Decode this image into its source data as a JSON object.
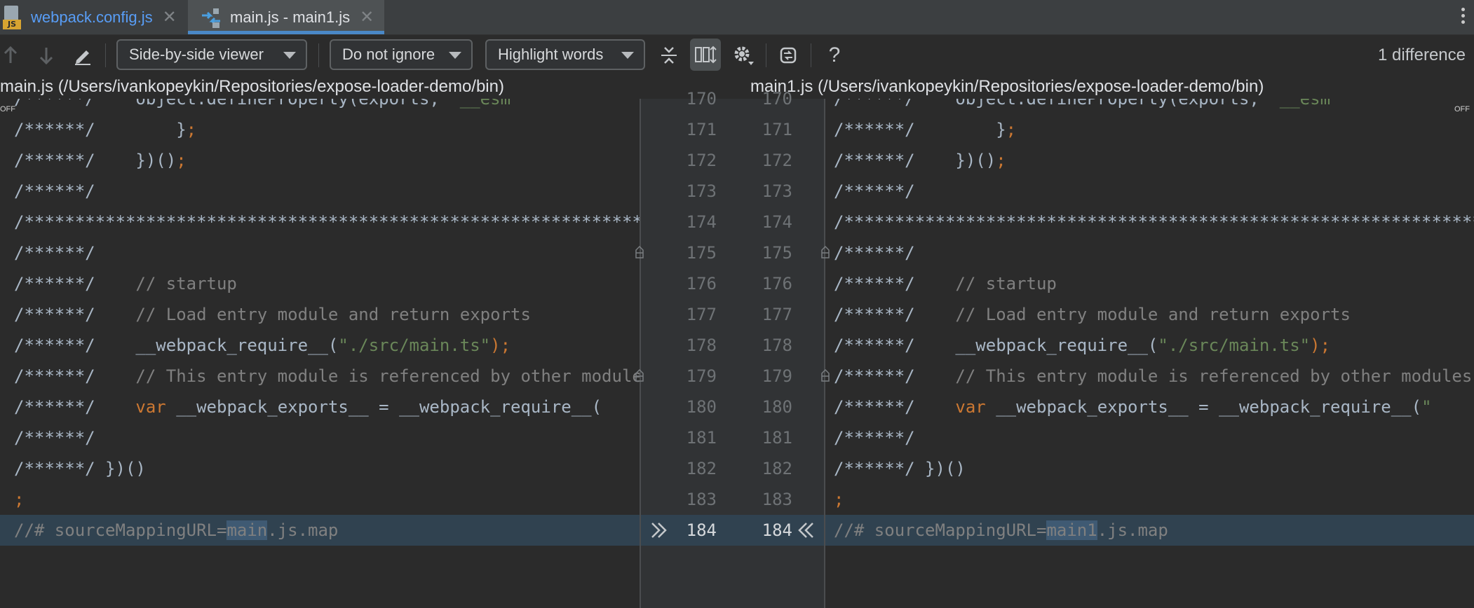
{
  "tabs": [
    {
      "label": "webpack.config.js",
      "icon": "javascript-file-icon",
      "badge": "JS",
      "active": false
    },
    {
      "label": "main.js - main1.js",
      "icon": "diff-icon",
      "active": true
    }
  ],
  "toolbar": {
    "viewer": "Side-by-side viewer",
    "ignore": "Do not ignore",
    "highlight": "Highlight words",
    "diff_count": "1 difference",
    "help": "?"
  },
  "left_file": {
    "title": "main.js (/Users/ivankopeykin/Repositories/expose-loader-demo/bin)"
  },
  "right_file": {
    "title": "main1.js (/Users/ivankopeykin/Repositories/expose-loader-demo/bin)"
  },
  "off_label": "OFF",
  "line_numbers": [
    "170",
    "171",
    "172",
    "173",
    "174",
    "175",
    "176",
    "177",
    "178",
    "179",
    "180",
    "181",
    "182",
    "183",
    "184"
  ],
  "left_lines": [
    {
      "prefix": "/******/",
      "a": "    object.defineProperty(exports, ",
      "b": "'__esm"
    },
    {
      "prefix": "/******/",
      "a": "        }",
      "b": ";"
    },
    {
      "prefix": "/******/",
      "a": "    })()",
      "b": ";"
    },
    {
      "prefix": "/******/",
      "a": "",
      "b": ""
    },
    {
      "prefix": "/**************************************************************************",
      "a": "",
      "b": ""
    },
    {
      "prefix": "/******/",
      "a": "",
      "b": ""
    },
    {
      "prefix": "/******/",
      "a": "    // startup",
      "b": ""
    },
    {
      "prefix": "/******/",
      "a": "    // Load entry module and return exports",
      "b": ""
    },
    {
      "prefix": "/******/",
      "a": "    __webpack_require__(",
      "s": "\"./src/main.ts\"",
      "e": ");"
    },
    {
      "prefix": "/******/",
      "a": "    // This entry module is referenced by other modules",
      "b": ""
    },
    {
      "prefix": "/******/",
      "kw": "    var",
      "a": " __webpack_exports__ = __webpack_require__(",
      "b": ""
    },
    {
      "prefix": "/******/",
      "a": "",
      "b": ""
    },
    {
      "prefix": "/******/",
      "a": " })()",
      "b": ""
    },
    {
      "prefix": "",
      "a": "",
      "b": ";"
    },
    {
      "prefix": "//# sourceMappingURL=",
      "w": "main",
      "a": ".js.map",
      "b": ""
    }
  ],
  "right_lines": [
    {
      "prefix": "/******/",
      "a": "    object.defineProperty(exports, ",
      "b": "'__esm"
    },
    {
      "prefix": "/******/",
      "a": "        }",
      "b": ";"
    },
    {
      "prefix": "/******/",
      "a": "    })()",
      "b": ";"
    },
    {
      "prefix": "/******/",
      "a": "",
      "b": ""
    },
    {
      "prefix": "/**************************************************************************",
      "a": "",
      "b": ""
    },
    {
      "prefix": "/******/",
      "a": "",
      "b": ""
    },
    {
      "prefix": "/******/",
      "a": "    // startup",
      "b": ""
    },
    {
      "prefix": "/******/",
      "a": "    // Load entry module and return exports",
      "b": ""
    },
    {
      "prefix": "/******/",
      "a": "    __webpack_require__(",
      "s": "\"./src/main.ts\"",
      "e": ");"
    },
    {
      "prefix": "/******/",
      "a": "    // This entry module is referenced by other modules",
      "b": ""
    },
    {
      "prefix": "/******/",
      "kw": "    var",
      "a": " __webpack_exports__ = __webpack_require__(",
      "s": "\"",
      "b": ""
    },
    {
      "prefix": "/******/",
      "a": "",
      "b": ""
    },
    {
      "prefix": "/******/",
      "a": " })()",
      "b": ""
    },
    {
      "prefix": "",
      "a": "",
      "b": ";"
    },
    {
      "prefix": "//# sourceMappingURL=",
      "w": "main1",
      "a": ".js.map",
      "b": ""
    }
  ]
}
